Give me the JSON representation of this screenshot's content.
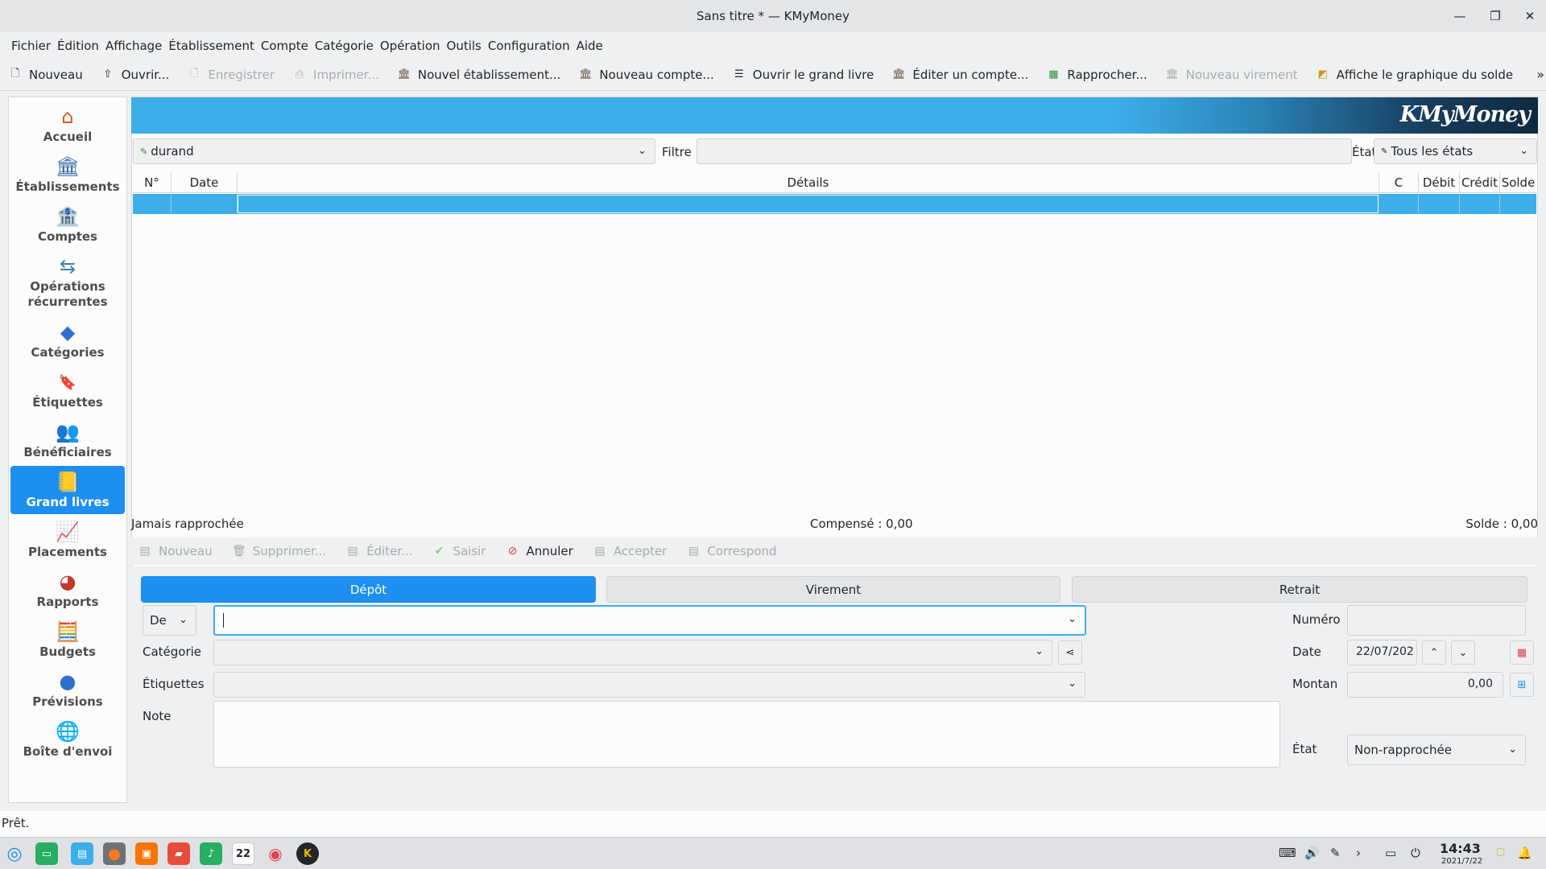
{
  "window": {
    "title": "Sans titre * — KMyMoney"
  },
  "menu": [
    "Fichier",
    "Édition",
    "Affichage",
    "Établissement",
    "Compte",
    "Catégorie",
    "Opération",
    "Outils",
    "Configuration",
    "Aide"
  ],
  "toolbar": {
    "nouveau": "Nouveau",
    "ouvrir": "Ouvrir...",
    "enregistrer": "Enregistrer",
    "imprimer": "Imprimer...",
    "nouvel_etablissement": "Nouvel établissement...",
    "nouveau_compte": "Nouveau compte...",
    "grand_livre": "Ouvrir le grand livre",
    "editer_compte": "Éditer un compte...",
    "rapprocher": "Rapprocher...",
    "nouveau_virement": "Nouveau virement",
    "graphique": "Affiche le graphique du solde"
  },
  "sidebar": {
    "items": [
      {
        "label": "Accueil",
        "icon": "home-icon"
      },
      {
        "label": "Établissements",
        "icon": "bank-icon"
      },
      {
        "label": "Comptes",
        "icon": "accounts-icon"
      },
      {
        "label": "Opérations récurrentes",
        "icon": "scheduled-icon"
      },
      {
        "label": "Catégories",
        "icon": "categories-icon"
      },
      {
        "label": "Étiquettes",
        "icon": "tag-icon"
      },
      {
        "label": "Bénéficiaires",
        "icon": "payees-icon"
      },
      {
        "label": "Grand livres",
        "icon": "ledger-icon"
      },
      {
        "label": "Placements",
        "icon": "investments-icon"
      },
      {
        "label": "Rapports",
        "icon": "reports-icon"
      },
      {
        "label": "Budgets",
        "icon": "budgets-icon"
      },
      {
        "label": "Prévisions",
        "icon": "forecast-icon"
      },
      {
        "label": "Boîte d'envoi",
        "icon": "outbox-icon"
      }
    ],
    "active": "Grand livres"
  },
  "banner": {
    "logo": "KMyMoney"
  },
  "ledger": {
    "account": "durand",
    "filter_label": "Filtre :",
    "filter_value": "",
    "state_label": "État",
    "state_value": "Tous les états",
    "columns": [
      "N°",
      "Date",
      "Détails",
      "C",
      "Débit",
      "Crédit",
      "Solde"
    ],
    "reconcile_status": "Jamais rapprochée",
    "cleared": "Compensé : 0,00",
    "balance": "Solde : 0,00"
  },
  "actions": {
    "nouveau": "Nouveau",
    "supprimer": "Supprimer...",
    "editer": "Éditer...",
    "saisir": "Saisir",
    "annuler": "Annuler",
    "accepter": "Accepter",
    "correspond": "Correspond"
  },
  "editor": {
    "tabs": [
      "Dépôt",
      "Virement",
      "Retrait"
    ],
    "active_tab": "Dépôt",
    "payee_prefix": "De",
    "payee_value": "",
    "category_label": "Catégorie",
    "tags_label": "Étiquettes",
    "note_label": "Note",
    "number_label": "Numéro",
    "number_value": "",
    "date_label": "Date",
    "date_value": "22/07/202",
    "amount_label": "Montan",
    "amount_value": "0,00",
    "state_label": "État",
    "state_value": "Non-rapprochée"
  },
  "statusbar": {
    "text": "Prêt."
  },
  "taskbar": {
    "calendar_day": "22",
    "clock_time": "14:43",
    "clock_date": "2021/7/22"
  }
}
